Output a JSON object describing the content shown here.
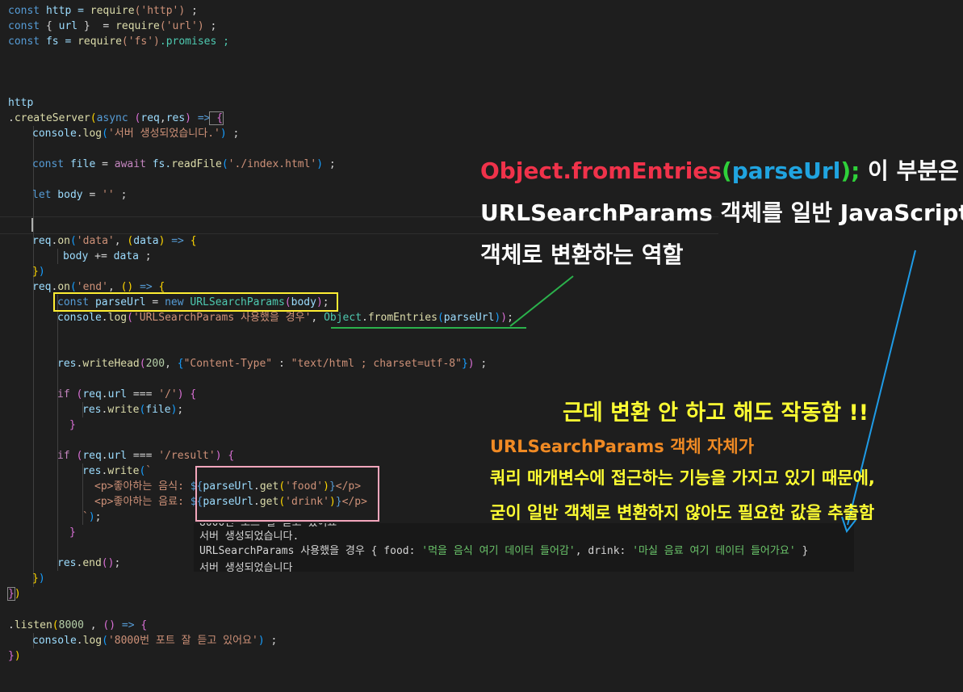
{
  "code": {
    "l1": {
      "t1": "const",
      "t2": " http = ",
      "t3": "require",
      "t4": "('http')",
      "t5": " ;"
    },
    "l2": {
      "t1": "const",
      "t2": " { ",
      "t3": "url",
      "t4": " }  = ",
      "t5": "require",
      "t6": "('url')",
      "t7": " ;"
    },
    "l3": {
      "t1": "const",
      "t2": " fs = ",
      "t3": "require",
      "t4": "('fs')",
      "t5": ".promises ;"
    },
    "l7": "http",
    "l8": {
      "t1": ".",
      "t2": "createServer",
      "t3": "(",
      "t4": "async",
      "t5": " (",
      "t6": "req",
      "t7": ",",
      "t8": "res",
      "t9": ") ",
      "t10": "=>",
      "t11": " {"
    },
    "l9": {
      "t1": "console",
      "t2": ".",
      "t3": "log",
      "t4": "(",
      "t5": "'서버 생성되었습니다.'",
      "t6": ")",
      "t7": " ;"
    },
    "l11": {
      "t1": "const",
      "t2": " file",
      "t3": " = ",
      "t4": "await",
      "t5": " fs.",
      "t6": "readFile",
      "t7": "(",
      "t8": "'./index.html'",
      "t9": ")",
      "t10": " ;"
    },
    "l13": {
      "t1": "let",
      "t2": " body",
      "t3": " = ",
      "t4": "''",
      "t5": " ;"
    },
    "l16": {
      "t1": "req",
      "t2": ".",
      "t3": "on",
      "t4": "(",
      "t5": "'data'",
      "t6": ", ",
      "t7": "(",
      "t8": "data",
      "t9": ") ",
      "t10": "=>",
      "t11": " {"
    },
    "l17": {
      "t1": "body",
      "t2": " += ",
      "t3": "data",
      "t4": " ;"
    },
    "l18": {
      "t1": "}",
      "t2": ")"
    },
    "l19": {
      "t1": "req",
      "t2": ".",
      "t3": "on",
      "t4": "(",
      "t5": "'end'",
      "t6": ", ",
      "t7": "() ",
      "t8": "=>",
      "t9": " {"
    },
    "l20": {
      "t1": "const",
      "t2": " parseUrl",
      "t3": " = ",
      "t4": "new",
      "t5": " URLSearchParams",
      "t6": "(",
      "t7": "body",
      "t8": ")",
      "t9": ";"
    },
    "l21": {
      "t1": "console",
      "t2": ".",
      "t3": "log",
      "t4": "(",
      "t5": "'URLSearchParams 사용했을 경우'",
      "t6": ", ",
      "t7": "Object",
      "t8": ".",
      "t9": "fromEntries",
      "t10": "(",
      "t11": "parseUrl",
      "t12": ")",
      "t13": ")",
      "t14": ";"
    },
    "l24": {
      "t1": "res",
      "t2": ".",
      "t3": "writeHead",
      "t4": "(",
      "t5": "200",
      "t6": ", ",
      "t7": "{",
      "t8": "\"Content-Type\"",
      "t9": " : ",
      "t10": "\"text/html ; charset=utf-8\"",
      "t11": "}",
      "t12": ")",
      "t13": " ;"
    },
    "l26": {
      "t1": "if",
      "t2": " ",
      "t3": "(",
      "t4": "req",
      "t5": ".",
      "t6": "url",
      "t7": " === ",
      "t8": "'/'",
      "t9": ")",
      "t10": " {"
    },
    "l27": {
      "t1": "res",
      "t2": ".",
      "t3": "write",
      "t4": "(",
      "t5": "file",
      "t6": ")",
      "t7": ";"
    },
    "l28": "}",
    "l30": {
      "t1": "if",
      "t2": " ",
      "t3": "(",
      "t4": "req",
      "t5": ".",
      "t6": "url",
      "t7": " === ",
      "t8": "'/result'",
      "t9": ")",
      "t10": " {"
    },
    "l31": {
      "t1": "res",
      "t2": ".",
      "t3": "write",
      "t4": "(",
      "t5": "`"
    },
    "l32": {
      "t1": "<p>좋아하는 음식: ",
      "t2": "${",
      "t3": "parseUrl",
      "t4": ".",
      "t5": "get",
      "t6": "(",
      "t7": "'food'",
      "t8": ")",
      "t9": "}",
      "t10": "</p>"
    },
    "l33": {
      "t1": "<p>좋아하는 음료: ",
      "t2": "${",
      "t3": "parseUrl",
      "t4": ".",
      "t5": "get",
      "t6": "(",
      "t7": "'drink'",
      "t8": ")",
      "t9": "}",
      "t10": "</p>"
    },
    "l34": {
      "t1": "`",
      "t2": ")",
      "t3": ";"
    },
    "l35": "}",
    "l37": {
      "t1": "res",
      "t2": ".",
      "t3": "end",
      "t4": "()",
      "t5": ";"
    },
    "l38": {
      "t1": "}",
      "t2": ")"
    },
    "l39": {
      "t1": "}",
      "t2": ")"
    },
    "l41": {
      "t1": ".",
      "t2": "listen",
      "t3": "(",
      "t4": "8000",
      "t5": " , ",
      "t6": "() ",
      "t7": "=>",
      "t8": " {"
    },
    "l42": {
      "t1": "console",
      "t2": ".",
      "t3": "log",
      "t4": "(",
      "t5": "'8000번 포트 잘 듣고 있어요'",
      "t6": ")",
      "t7": " ;"
    },
    "l43": {
      "t1": "}",
      "t2": ")"
    }
  },
  "terminal": {
    "line0": "8000번 포트 잘 듣고 있어요",
    "line1": "서버 생성되었습니다.",
    "line2": {
      "p1": "URLSearchParams 사용했을 경우 { food: ",
      "s1": "'먹을 음식 여기 데이터 들어감'",
      "p2": ", drink: ",
      "s2": "'마실 음료 여기 데이터 들어가요'",
      "p3": " }"
    },
    "line3": "서버 생성되었습니다"
  },
  "annotations": {
    "top": {
      "obj": "Object.fromEntries",
      "paren_open": "(",
      "arg": "parseUrl",
      "paren_close": ");",
      "rest1": " 이 부분은",
      "line2": "URLSearchParams 객체를 일반 JavaScript",
      "line3": "객체로 변환하는 역할"
    },
    "bottom": {
      "headline": "근데 변환 안 하고 해도 작동함 !!",
      "line1": "URLSearchParams 객체 자체가",
      "line2": "쿼리 매개변수에 접근하는 기능을 가지고 있기 때문에,",
      "line3": "굳이 일반 객체로 변환하지 않아도 필요한 값을 추출함"
    }
  },
  "colors": {
    "editor_bg": "#1e1e1e",
    "highlight_box_yellow": "#ffee33",
    "highlight_box_pink": "#f3a6bc",
    "arrow_green": "#2bb24c",
    "arrow_blue": "#1e9be6"
  }
}
